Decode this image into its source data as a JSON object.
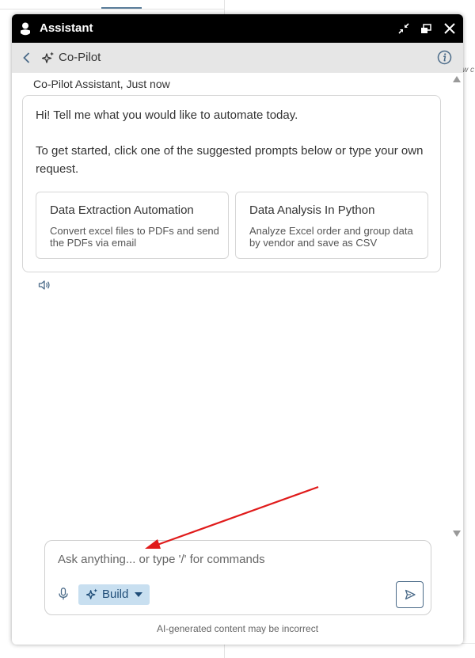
{
  "background": {
    "edge_text": "w c"
  },
  "window": {
    "title": "Assistant",
    "minimize_icon": "collapse-arrows-icon",
    "popout_icon": "popout-window-icon",
    "close_icon": "close-icon"
  },
  "header": {
    "title": "Co-Pilot",
    "back_icon": "chevron-left-icon",
    "info_icon": "info-icon"
  },
  "chat": {
    "sender": "Co-Pilot Assistant,  Just now",
    "greeting": "Hi! Tell me what you would like to automate today.",
    "instructions": "To get started, click one of the suggested prompts below or type your own request.",
    "suggestions": [
      {
        "title": "Data Extraction Automation",
        "description": "Convert excel files to PDFs and send the PDFs via email"
      },
      {
        "title": "Data Analysis In Python",
        "description": "Analyze Excel order and group data by vendor and save as CSV"
      }
    ]
  },
  "composer": {
    "value": "",
    "placeholder": "Ask anything... or type '/' for commands",
    "mode_label": "Build",
    "disclaimer": "AI-generated content may be incorrect"
  },
  "colors": {
    "titlebar": "#000000",
    "subbar": "#e6e6e6",
    "build_bg": "#c8dff0",
    "build_text": "#1f4d78",
    "annotation_arrow": "#e01b1b"
  }
}
